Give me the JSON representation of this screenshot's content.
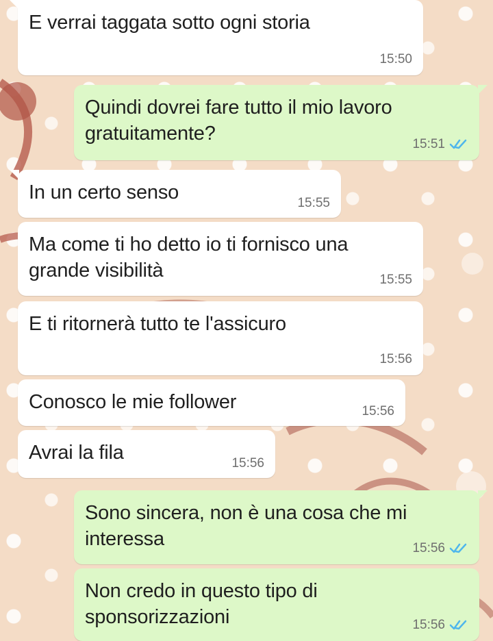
{
  "messages": [
    {
      "direction": "incoming",
      "text": "E verrai taggata sotto ogni storia",
      "time": "15:50",
      "read": false
    },
    {
      "direction": "outgoing",
      "text": "Quindi dovrei fare tutto il mio lavoro\ngratuitamente?",
      "time": "15:51",
      "read": true
    },
    {
      "direction": "incoming",
      "text": "In un certo senso",
      "time": "15:55",
      "read": false
    },
    {
      "direction": "incoming",
      "text": "Ma come ti ho detto io ti fornisco una\ngrande visibilità",
      "time": "15:55",
      "read": false
    },
    {
      "direction": "incoming",
      "text": "E ti ritornerà tutto te l'assicuro",
      "time": "15:56",
      "read": false
    },
    {
      "direction": "incoming",
      "text": "Conosco le mie follower",
      "time": "15:56",
      "read": false
    },
    {
      "direction": "incoming",
      "text": "Avrai la fila",
      "time": "15:56",
      "read": false
    },
    {
      "direction": "outgoing",
      "text": "Sono sincera, non è una cosa che mi\ninteressa",
      "time": "15:56",
      "read": true
    },
    {
      "direction": "outgoing",
      "text": "Non credo in questo tipo di\nsponsorizzazioni",
      "time": "15:56",
      "read": true
    }
  ],
  "colors": {
    "incoming_bubble": "#ffffff",
    "outgoing_bubble": "#ddf8c8",
    "read_ticks": "#4fb6ec",
    "wallpaper": "#f4dcc6"
  },
  "icons": {
    "read_receipt": "double-check-icon"
  }
}
